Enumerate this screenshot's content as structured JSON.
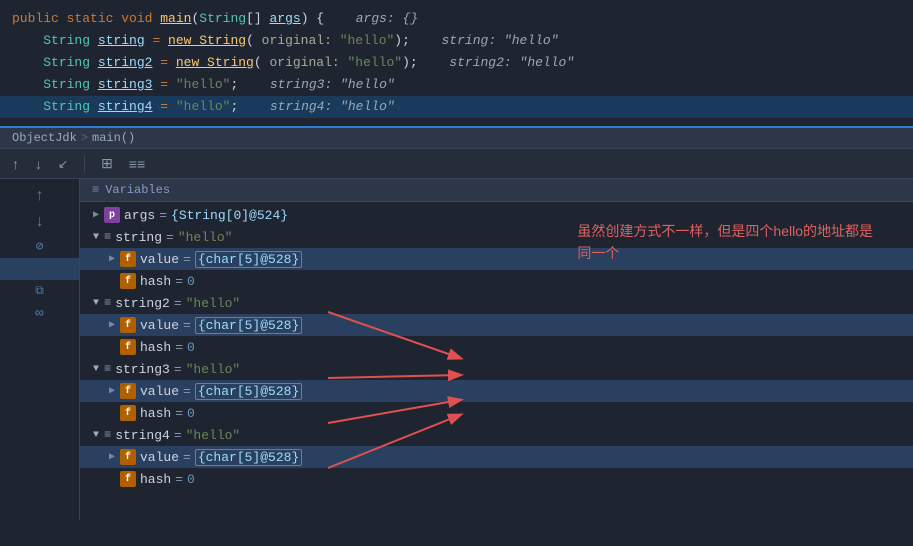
{
  "code": {
    "line1": {
      "text": "public static void main(String[] args) {",
      "hint": "  args: {}"
    },
    "line2": {
      "indent": "    ",
      "type": "String",
      "var": "string",
      "op": " = ",
      "constructor": "new String",
      "params": "( original: \"hello\");",
      "hint": "  string: \"hello\""
    },
    "line3": {
      "indent": "    ",
      "type": "String",
      "var": "string2",
      "op": " = ",
      "constructor": "new String",
      "params": "( original: \"hello\");",
      "hint": "  string2: \"hello\""
    },
    "line4": {
      "indent": "    ",
      "type": "String",
      "var": "string3",
      "op": " = ",
      "val": "\"hello\";",
      "hint": "  string3: \"hello\""
    },
    "line5": {
      "indent": "    ",
      "type": "String",
      "var": "string4",
      "op": " = ",
      "val": "\"hello\";",
      "hint": "  string4: \"hello\""
    }
  },
  "breadcrumb": {
    "class": "ObjectJdk",
    "sep": ">",
    "method": "main()"
  },
  "toolbar": {
    "buttons": [
      "↑",
      "↓",
      "↓↑",
      "⊞",
      "≡"
    ]
  },
  "panel": {
    "header": "Variables"
  },
  "variables": [
    {
      "id": "args",
      "indent": 0,
      "icon": "p",
      "name": "args",
      "eq": "=",
      "value": "{String[0]@524}",
      "type": "ref",
      "expanded": false
    },
    {
      "id": "string",
      "indent": 0,
      "icon": "list",
      "name": "string",
      "eq": "=",
      "value": "\"hello\"",
      "type": "str",
      "expanded": true
    },
    {
      "id": "string-value",
      "indent": 1,
      "icon": "f",
      "name": "value",
      "eq": "=",
      "value": "{char[5]@528}",
      "type": "highlight",
      "expanded": false,
      "selected": true
    },
    {
      "id": "string-hash",
      "indent": 1,
      "icon": "f",
      "name": "hash",
      "eq": "=",
      "value": "0",
      "type": "num",
      "expanded": false
    },
    {
      "id": "string2",
      "indent": 0,
      "icon": "list",
      "name": "string2",
      "eq": "=",
      "value": "\"hello\"",
      "type": "str",
      "expanded": true
    },
    {
      "id": "string2-value",
      "indent": 1,
      "icon": "f",
      "name": "value",
      "eq": "=",
      "value": "{char[5]@528}",
      "type": "highlight",
      "expanded": false,
      "selected": true
    },
    {
      "id": "string2-hash",
      "indent": 1,
      "icon": "f",
      "name": "hash",
      "eq": "=",
      "value": "0",
      "type": "num",
      "expanded": false
    },
    {
      "id": "string3",
      "indent": 0,
      "icon": "list",
      "name": "string3",
      "eq": "=",
      "value": "\"hello\"",
      "type": "str",
      "expanded": true
    },
    {
      "id": "string3-value",
      "indent": 1,
      "icon": "f",
      "name": "value",
      "eq": "=",
      "value": "{char[5]@528}",
      "type": "highlight",
      "expanded": false,
      "selected": true
    },
    {
      "id": "string3-hash",
      "indent": 1,
      "icon": "f",
      "name": "hash",
      "eq": "=",
      "value": "0",
      "type": "num",
      "expanded": false
    },
    {
      "id": "string4",
      "indent": 0,
      "icon": "list",
      "name": "string4",
      "eq": "=",
      "value": "\"hello\"",
      "type": "str",
      "expanded": true
    },
    {
      "id": "string4-value",
      "indent": 1,
      "icon": "f",
      "name": "value",
      "eq": "=",
      "value": "{char[5]@528}",
      "type": "highlight",
      "expanded": false,
      "selected": true
    },
    {
      "id": "string4-hash",
      "indent": 1,
      "icon": "f",
      "name": "hash",
      "eq": "=",
      "value": "0",
      "type": "num",
      "expanded": false
    }
  ],
  "annotation": {
    "text": "虽然创建方式不一样，但是四个hello的地址都是\n同一个"
  },
  "colors": {
    "bg": "#1e2530",
    "highlight_line": "#1a3a5c",
    "accent_blue": "#2a7fd4"
  }
}
